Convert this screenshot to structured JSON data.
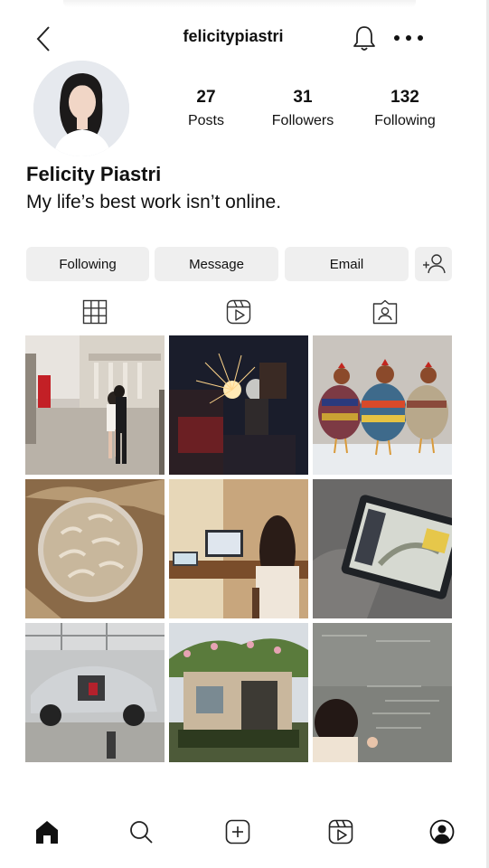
{
  "header": {
    "username": "felicitypiastri",
    "icons": [
      "chevron-left-icon",
      "bell-icon",
      "more-icon"
    ]
  },
  "profile": {
    "display_name": "Felicity Piastri",
    "bio": "My life’s best work isn’t online.",
    "stats": [
      {
        "value": "27",
        "label": "Posts"
      },
      {
        "value": "31",
        "label": "Followers"
      },
      {
        "value": "132",
        "label": "Following"
      }
    ]
  },
  "actions": {
    "following": "Following",
    "message": "Message",
    "email": "Email",
    "add_user_icon": "add-user-icon"
  },
  "tabs": [
    "grid-icon",
    "reels-icon",
    "tagged-icon"
  ],
  "posts": [
    "couple embracing on a city street with red phone box",
    "person welding with sparks in a dark workshop",
    "three chickens wearing knitted sweaters in snow",
    "crusty loaf of bread on baking paper",
    "woman working at a laptop on a desk",
    "tablet showing a racing data screen on a blanket",
    "stripped vintage car body in a garage",
    "ivy-covered garden shed",
    "woman writing equations on a chalkboard"
  ],
  "bottom_nav": [
    "home-icon",
    "search-icon",
    "create-post-icon",
    "reels-icon",
    "profile-icon"
  ],
  "colors": {
    "button_bg": "#efefef",
    "text": "#111111",
    "background": "#ffffff"
  }
}
